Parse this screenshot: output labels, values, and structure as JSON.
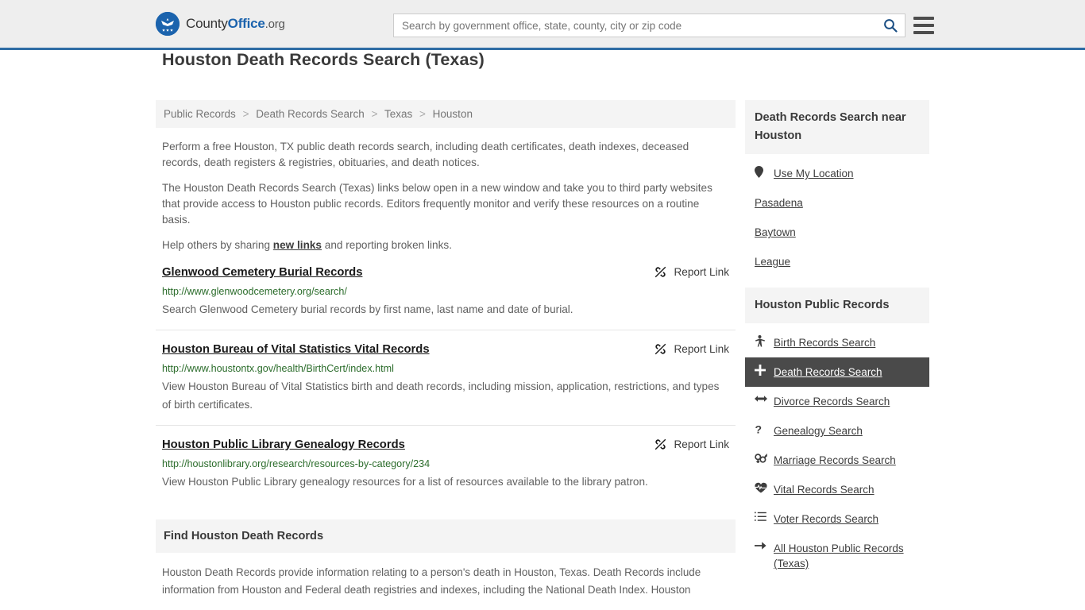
{
  "header": {
    "brand": {
      "part1": "County",
      "part2": "Office",
      "part3": ".org",
      "logo_icon": "eagle-seal-logo"
    },
    "search": {
      "placeholder": "Search by government office, state, county, city or zip code",
      "value": "",
      "button_icon": "search-icon"
    },
    "menu_icon": "hamburger-menu-icon",
    "accent_color": "#2e6ca4"
  },
  "page": {
    "title": "Houston Death Records Search (Texas)"
  },
  "breadcrumb": {
    "items": [
      "Public Records",
      "Death Records Search",
      "Texas",
      "Houston"
    ],
    "separator": ">"
  },
  "intro": {
    "p1": "Perform a free Houston, TX public death records search, including death certificates, death indexes, deceased records, death registers & registries, obituaries, and death notices.",
    "p2": "The Houston Death Records Search (Texas) links below open in a new window and take you to third party websites that provide access to Houston public records. Editors frequently monitor and verify these resources on a routine basis.",
    "p3_before": "Help others by sharing ",
    "p3_link": "new links",
    "p3_after": " and reporting broken links."
  },
  "results": {
    "report_label": "Report Link",
    "report_icon": "broken-link-icon",
    "items": [
      {
        "title": "Glenwood Cemetery Burial Records",
        "url": "http://www.glenwoodcemetery.org/search/",
        "description": "Search Glenwood Cemetery burial records by first name, last name and date of burial."
      },
      {
        "title": "Houston Bureau of Vital Statistics Vital Records",
        "url": "http://www.houstontx.gov/health/BirthCert/index.html",
        "description": "View Houston Bureau of Vital Statistics birth and death records, including mission, application, restrictions, and types of birth certificates."
      },
      {
        "title": "Houston Public Library Genealogy Records",
        "url": "http://houstonlibrary.org/research/resources-by-category/234",
        "description": "View Houston Public Library genealogy resources for a list of resources available to the library patron."
      }
    ]
  },
  "find_section": {
    "heading": "Find Houston Death Records",
    "body": "Houston Death Records provide information relating to a person's death in Houston, Texas. Death Records include information from Houston and Federal death registries and indexes, including the National Death Index. Houston"
  },
  "sidebar": {
    "near_card": {
      "heading": "Death Records Search near Houston",
      "items": [
        {
          "label": "Use My Location",
          "icon": "map-pin-icon",
          "has_icon": true
        },
        {
          "label": "Pasadena",
          "icon": "",
          "has_icon": false
        },
        {
          "label": "Baytown",
          "icon": "",
          "has_icon": false
        },
        {
          "label": "League",
          "icon": "",
          "has_icon": false
        }
      ]
    },
    "public_records_card": {
      "heading": "Houston Public Records",
      "items": [
        {
          "label": "Birth Records Search",
          "icon": "child-icon",
          "active": false
        },
        {
          "label": "Death Records Search",
          "icon": "cross-icon",
          "active": true
        },
        {
          "label": "Divorce Records Search",
          "icon": "left-right-arrow-icon",
          "active": false
        },
        {
          "label": "Genealogy Search",
          "icon": "question-mark-icon",
          "active": false
        },
        {
          "label": "Marriage Records Search",
          "icon": "venus-mars-icon",
          "active": false
        },
        {
          "label": "Vital Records Search",
          "icon": "heartbeat-icon",
          "active": false
        },
        {
          "label": "Voter Records Search",
          "icon": "ordered-list-icon",
          "active": false
        },
        {
          "label": "All Houston Public Records (Texas)",
          "icon": "arrow-right-icon",
          "active": false
        }
      ]
    }
  }
}
